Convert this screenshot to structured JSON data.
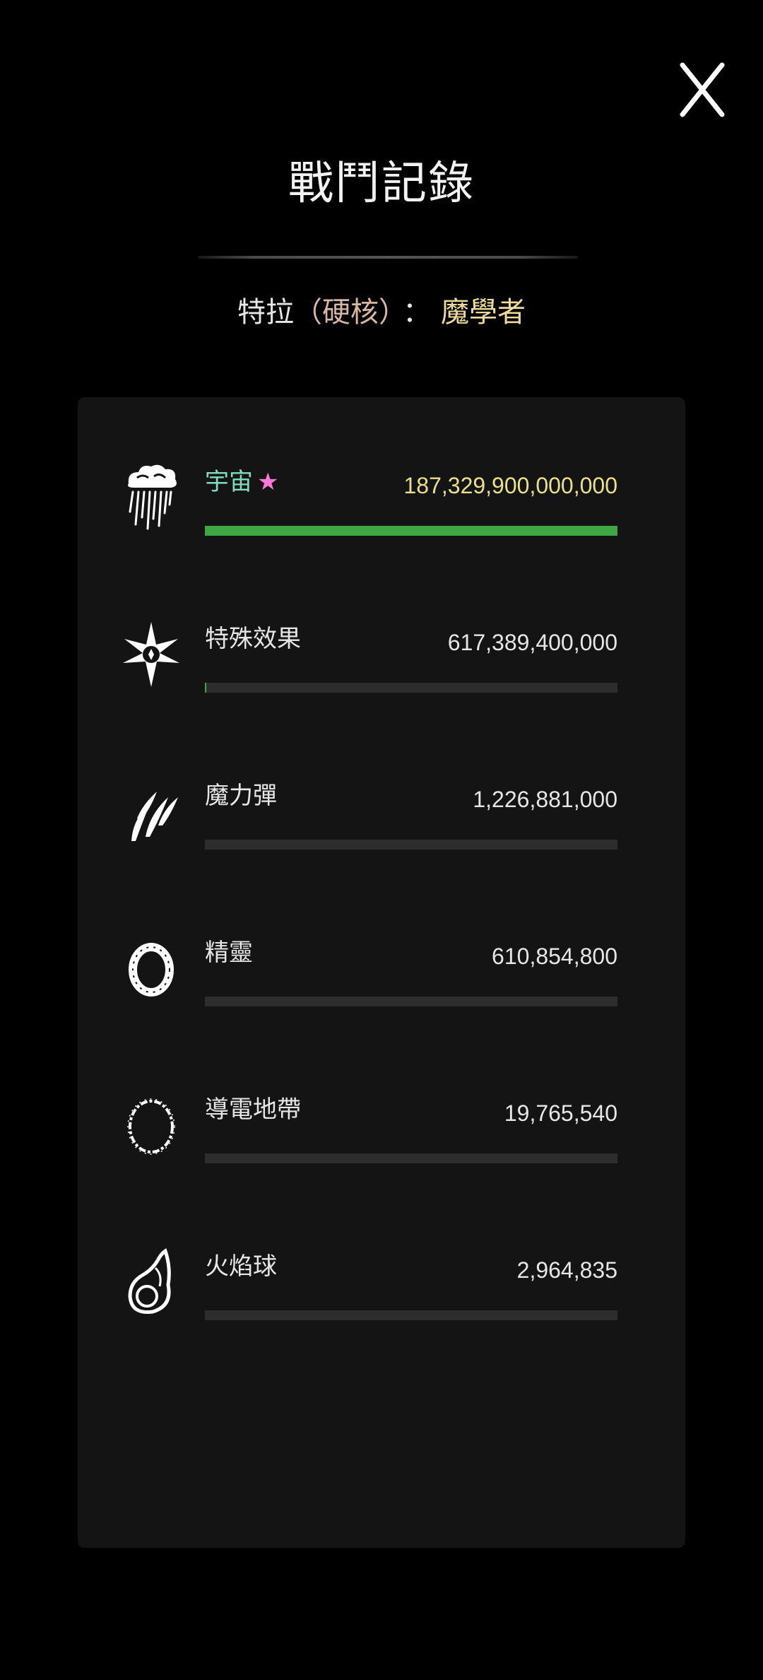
{
  "header": {
    "title": "戰鬥記錄",
    "close_icon": "close-x-icon"
  },
  "character": {
    "name": "特拉",
    "mode": "（硬核）",
    "separator": "：",
    "class": "魔學者"
  },
  "colors": {
    "bar_fill": "#3ea845",
    "bar_track": "#2d2d2d",
    "highlight_name": "#7fdcc0",
    "highlight_value": "#e8e08a",
    "star": "#ff7ad8",
    "class_name": "#f0dc9a",
    "mode_text": "#d8b6a4"
  },
  "skills": [
    {
      "name": "宇宙",
      "star": "★",
      "value": "187,329,900,000,000",
      "fraction": 1.0,
      "icon": "cosmos-cloud-rain-icon",
      "highlight": true
    },
    {
      "name": "特殊效果",
      "star": "",
      "value": "617,389,400,000",
      "fraction": 0.0033,
      "icon": "starburst-effect-icon",
      "highlight": false
    },
    {
      "name": "魔力彈",
      "star": "",
      "value": "1,226,881,000",
      "fraction": 0.0,
      "icon": "magic-missile-claw-icon",
      "highlight": false
    },
    {
      "name": "精靈",
      "star": "",
      "value": "610,854,800",
      "fraction": 0.0,
      "icon": "spirit-ring-icon",
      "highlight": false
    },
    {
      "name": "導電地帶",
      "star": "",
      "value": "19,765,540",
      "fraction": 0.0,
      "icon": "conductive-zone-ring-icon",
      "highlight": false
    },
    {
      "name": "火焰球",
      "star": "",
      "value": "2,964,835",
      "fraction": 0.0,
      "icon": "fireball-icon",
      "highlight": false
    }
  ]
}
